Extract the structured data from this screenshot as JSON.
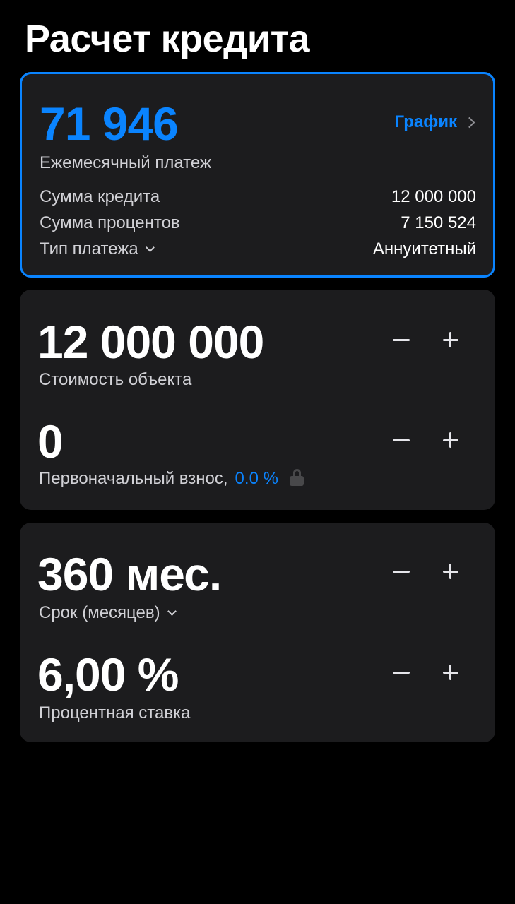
{
  "page": {
    "title": "Расчет кредита"
  },
  "summary": {
    "monthly_payment_value": "71 946",
    "monthly_payment_label": "Ежемесячный платеж",
    "schedule_link_label": "График",
    "rows": [
      {
        "label": "Сумма кредита",
        "value": "12 000 000"
      },
      {
        "label": "Сумма процентов",
        "value": "7 150 524"
      },
      {
        "label": "Тип платежа",
        "value": "Аннуитетный"
      }
    ]
  },
  "property": {
    "cost_value": "12 000 000",
    "cost_label": "Стоимость объекта",
    "down_payment_value": "0",
    "down_payment_label": "Первоначальный взнос,",
    "down_payment_percent": "0.0 %"
  },
  "loan_terms": {
    "term_value": "360 мес.",
    "term_label": "Срок (месяцев)",
    "rate_value": "6,00 %",
    "rate_label": "Процентная ставка"
  },
  "colors": {
    "accent": "#0a84ff",
    "background": "#000000",
    "card": "#1c1c1e"
  },
  "icons": [
    "chevron-right-icon",
    "chevron-down-icon",
    "minus-icon",
    "plus-icon",
    "lock-icon"
  ]
}
